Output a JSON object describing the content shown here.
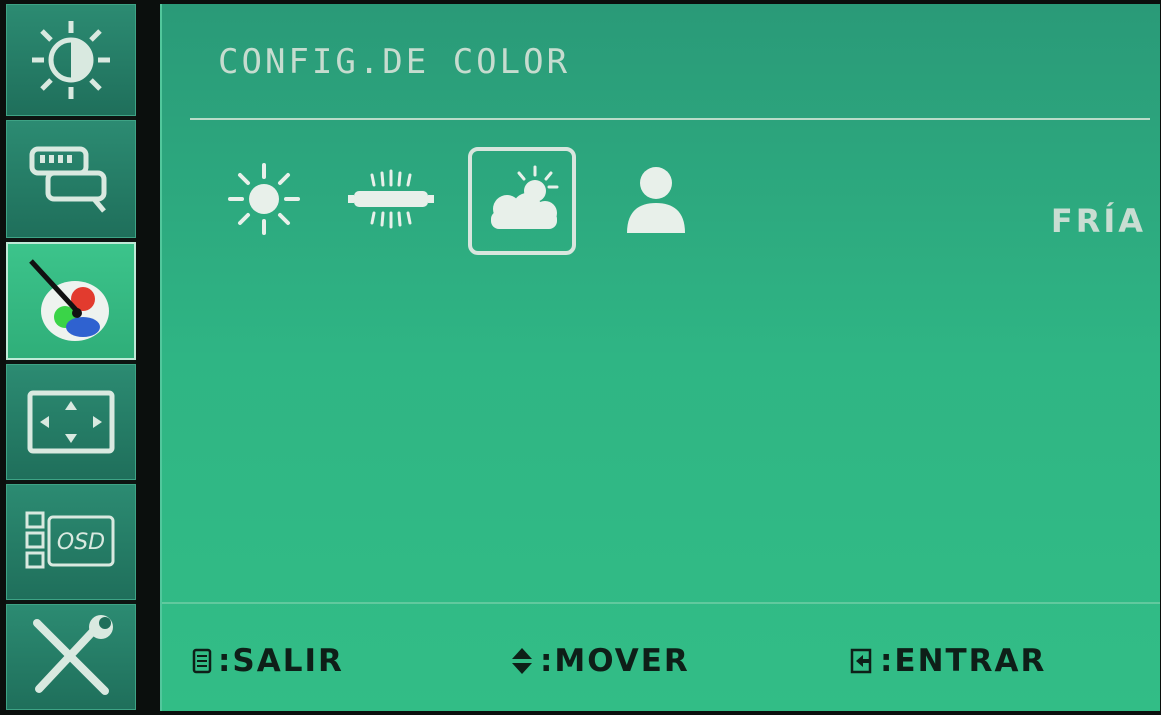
{
  "sidebar": {
    "items": [
      {
        "name": "brightness-contrast",
        "icon": "brightness-contrast-icon"
      },
      {
        "name": "image-setup",
        "icon": "image-setup-icon"
      },
      {
        "name": "color-setup",
        "icon": "color-palette-icon",
        "active": true
      },
      {
        "name": "position",
        "icon": "position-arrows-icon"
      },
      {
        "name": "osd-setup",
        "icon": "osd-icon",
        "icon_text": "OSD"
      },
      {
        "name": "extra",
        "icon": "tools-icon"
      }
    ]
  },
  "panel": {
    "title": "CONFIG.DE COLOR",
    "presets": [
      {
        "icon": "sun-warm-icon"
      },
      {
        "icon": "fluorescent-normal-icon"
      },
      {
        "icon": "cloudy-cool-icon",
        "selected": true
      },
      {
        "icon": "user-icon"
      }
    ],
    "selected_value": "FRÍA"
  },
  "footer": {
    "exit_label": ":SALIR",
    "move_label": ":MOVER",
    "enter_label": ":ENTRAR"
  },
  "colors": {
    "panel_green": "#2fb584",
    "sidebar_teal": "#1f6f5b",
    "active_green": "#3cc48b",
    "text_light": "#c6dccf",
    "text_dark": "#0e1f18"
  }
}
